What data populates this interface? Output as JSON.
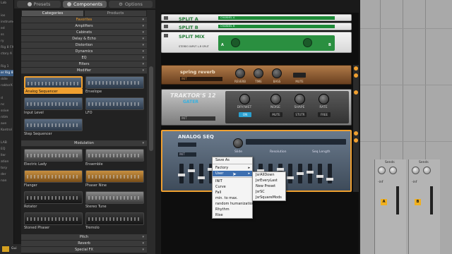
{
  "colors": {
    "accent": "#f0a030",
    "split_green": "#1e8a38",
    "menu_highlight": "#3d6fb0",
    "gater_blue": "#2aa0d0"
  },
  "top_tabs": [
    {
      "label": "Presets",
      "icon": "presets-icon"
    },
    {
      "label": "Components",
      "icon": "components-icon"
    },
    {
      "label": "Options",
      "icon": "gear-icon"
    }
  ],
  "sub_tabs": [
    "Categories",
    "Products"
  ],
  "categories_top": [
    {
      "label": "Favorites",
      "highlight": true
    },
    {
      "label": "Amplifiers"
    },
    {
      "label": "Cabinets"
    },
    {
      "label": "Delay & Echo"
    },
    {
      "label": "Distortion"
    },
    {
      "label": "Dynamics"
    },
    {
      "label": "EQ"
    },
    {
      "label": "Filters"
    },
    {
      "label": "Modifier"
    }
  ],
  "modifier_tiles": [
    {
      "label": "Analog Sequencer",
      "selected": true,
      "style": "blue"
    },
    {
      "label": "Envelope",
      "style": "blue"
    },
    {
      "label": "Input Level",
      "style": "blue"
    },
    {
      "label": "LFO",
      "style": "blue"
    },
    {
      "label": "Step Sequencer",
      "style": "blue"
    }
  ],
  "modulation_header": "Modulation",
  "modulation_tiles": [
    {
      "label": "Electric Lady",
      "style": "grey"
    },
    {
      "label": "Ensemble",
      "style": "grey"
    },
    {
      "label": "Flanger",
      "style": "orange"
    },
    {
      "label": "Phaser Nine",
      "style": "orange"
    },
    {
      "label": "Rotator",
      "style": "dark"
    },
    {
      "label": "Stereo Tune",
      "style": "grey"
    },
    {
      "label": "Stoned Phaser",
      "style": "dark"
    },
    {
      "label": "Tremolo",
      "style": "dark"
    }
  ],
  "categories_bottom": [
    {
      "label": "Pitch"
    },
    {
      "label": "Reverb"
    },
    {
      "label": "Special FX"
    }
  ],
  "rack": {
    "split_a": {
      "name": "SPLIT A",
      "bar": "CHANNEL A"
    },
    "split_b": {
      "name": "SPLIT B",
      "bar": "CHANNEL B"
    },
    "split_mix": {
      "name": "SPLIT MIX",
      "signal": "STEREO INPUT L-R SPLIT",
      "a": "A",
      "b": "B"
    },
    "reverb": {
      "name": "spring reverb",
      "preset": "INIT",
      "knobs": [
        "REVERB",
        "TIME",
        "BASS",
        "MUTE"
      ]
    },
    "gater": {
      "title": "TRAKTOR'S 12",
      "sub": "GATER",
      "preset": "INIT",
      "knobs": [
        "DRY/WET",
        "NOISE",
        "SHAPE",
        "RATE"
      ],
      "buttons": [
        "ON",
        "MUTE",
        "STUTR",
        "FREE"
      ]
    },
    "seq": {
      "title": "ANALOG SEQ",
      "preset": "INIT",
      "labels": [
        "Slide",
        "Resolution",
        "Seq Length"
      ]
    }
  },
  "menu_main": [
    {
      "label": "Save As"
    },
    {
      "label": "Factory",
      "sub": true
    },
    {
      "label": "User",
      "sub": true,
      "highlight": true
    },
    {
      "label": "INIT"
    },
    {
      "label": "Curve"
    },
    {
      "label": "Fall"
    },
    {
      "label": "min. to max."
    },
    {
      "label": "random humanization"
    },
    {
      "label": "Rhythm"
    },
    {
      "label": "Rise"
    }
  ],
  "menu_user": [
    {
      "label": "JsrAllDown"
    },
    {
      "label": "JsrEveryLast"
    },
    {
      "label": "New Preset"
    },
    {
      "label": "JsrSC"
    },
    {
      "label": "JsrSquareMods"
    }
  ],
  "host_left_items": [
    "Lab",
    "",
    "ios",
    "instruments",
    "ed",
    "ss",
    "ry",
    "Rig 8 FX",
    "ctory A",
    "",
    "Rig 1",
    "er Rig 8 M",
    "ddle",
    "raktorX FX",
    "",
    "d",
    "nc",
    "ssive",
    "ntim",
    "ave",
    "Kontrol",
    "",
    "LAB",
    "EQ",
    "ller",
    "ation",
    "tory",
    "der",
    "nan"
  ],
  "host_right": {
    "sends_label": "Sends",
    "strip_a": {
      "value": "-inf",
      "ab": "A"
    },
    "strip_b": {
      "value": "-inf",
      "ab": "B"
    }
  },
  "bottom": {
    "label": "Gui"
  }
}
